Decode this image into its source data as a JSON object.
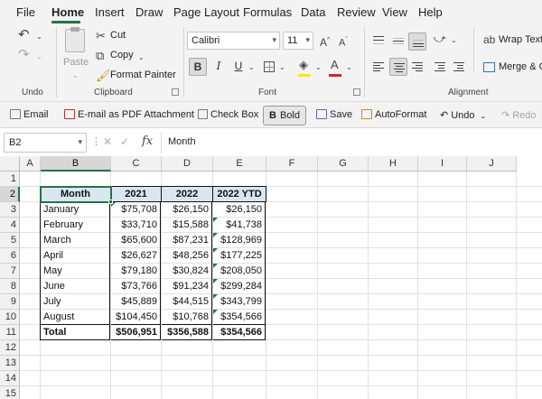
{
  "menu": {
    "tabs": [
      "File",
      "Home",
      "Insert",
      "Draw",
      "Page Layout",
      "Formulas",
      "Data",
      "Review",
      "View",
      "Help"
    ],
    "active": "Home"
  },
  "ribbon": {
    "undo_group": "Undo",
    "clipboard": {
      "paste": "Paste",
      "cut": "Cut",
      "copy": "Copy",
      "format_painter": "Format Painter",
      "label": "Clipboard"
    },
    "font": {
      "name": "Calibri",
      "size": "11",
      "label": "Font"
    },
    "alignment": {
      "wrap_text": "Wrap Text",
      "merge": "Merge & C",
      "label": "Alignment"
    }
  },
  "qat": {
    "email": "Email",
    "email_pdf": "E-mail as PDF Attachment",
    "check_box": "Check Box",
    "bold": "Bold",
    "save": "Save",
    "autoformat": "AutoFormat",
    "undo": "Undo",
    "redo": "Redo"
  },
  "formula_bar": {
    "name_box": "B2",
    "content": "Month"
  },
  "grid": {
    "columns": [
      "A",
      "B",
      "C",
      "D",
      "E",
      "F",
      "G",
      "H",
      "I",
      "J"
    ],
    "rows": [
      "1",
      "2",
      "3",
      "4",
      "5",
      "6",
      "7",
      "8",
      "9",
      "10",
      "11",
      "12",
      "13",
      "14",
      "15"
    ],
    "selected_cell": "B2"
  },
  "table": {
    "headers": [
      "Month",
      "2021",
      "2022",
      "2022 YTD"
    ],
    "rows": [
      [
        "January",
        "$75,708",
        "$26,150",
        "$26,150"
      ],
      [
        "February",
        "$33,710",
        "$15,588",
        "$41,738"
      ],
      [
        "March",
        "$65,600",
        "$87,231",
        "$128,969"
      ],
      [
        "April",
        "$26,627",
        "$48,256",
        "$177,225"
      ],
      [
        "May",
        "$79,180",
        "$30,824",
        "$208,050"
      ],
      [
        "June",
        "$73,766",
        "$91,234",
        "$299,284"
      ],
      [
        "July",
        "$45,889",
        "$44,515",
        "$343,799"
      ],
      [
        "August",
        "$104,450",
        "$10,768",
        "$354,566"
      ]
    ],
    "total": [
      "Total",
      "$506,951",
      "$356,588",
      "$354,566"
    ]
  },
  "colors": {
    "accent": "#217346",
    "header_fill": "#d9e6f0",
    "ribbon_bg": "#f3f3f3"
  }
}
